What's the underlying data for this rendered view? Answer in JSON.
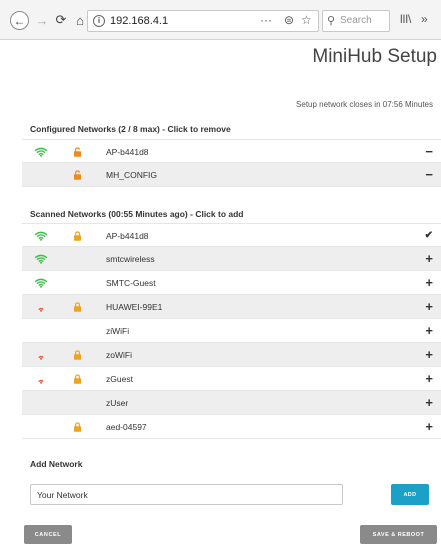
{
  "browser": {
    "url": "192.168.4.1",
    "search_placeholder": "Search",
    "back_glyph": "←",
    "forward_glyph": "→",
    "reload_glyph": "⟳",
    "home_glyph": "⌂",
    "more_glyph": "···",
    "pocket_glyph": "⊜",
    "star_glyph": "☆",
    "library_glyph": "lll\\",
    "overflow_glyph": "»"
  },
  "page": {
    "title": "MiniHub Setup",
    "setup_closes": "Setup network closes in 07:56 Minutes"
  },
  "configured": {
    "title": "Configured Networks (2 / 8 max) - Click to remove",
    "networks": [
      {
        "ssid": "AP-b441d8",
        "signal": "strong",
        "security": "config",
        "action": "−"
      },
      {
        "ssid": "MH_CONFIG",
        "signal": "none",
        "security": "config",
        "action": "−"
      }
    ]
  },
  "scanned": {
    "title": "Scanned Networks (00:55 Minutes ago) - Click to add",
    "networks": [
      {
        "ssid": "AP-b441d8",
        "signal": "strong",
        "locked": true,
        "action": "✔"
      },
      {
        "ssid": "smtcwireless",
        "signal": "strong",
        "locked": false,
        "action": "+"
      },
      {
        "ssid": "SMTC-Guest",
        "signal": "strong",
        "locked": false,
        "action": "+"
      },
      {
        "ssid": "HUAWEI-99E1",
        "signal": "weak",
        "locked": true,
        "action": "+"
      },
      {
        "ssid": "ziWiFi",
        "signal": "none",
        "locked": false,
        "action": "+"
      },
      {
        "ssid": "zoWiFi",
        "signal": "weak",
        "locked": true,
        "action": "+"
      },
      {
        "ssid": "zGuest",
        "signal": "weak",
        "locked": true,
        "action": "+"
      },
      {
        "ssid": "zUser",
        "signal": "none",
        "locked": false,
        "action": "+"
      },
      {
        "ssid": "aed-04597",
        "signal": "none",
        "locked": true,
        "action": "+"
      }
    ]
  },
  "add_network": {
    "title": "Add Network",
    "input_value": "Your Network",
    "add_label": "ADD"
  },
  "buttons": {
    "cancel_label": "CANCEL",
    "save_reboot_label": "SAVE & REBOOT"
  },
  "colors": {
    "wifi_strong": "#3dbf4a",
    "wifi_weak": "#e8593a",
    "wifi_none": "#d6d6d6",
    "lock": "#f0a320",
    "config_lock": "#f08a1e",
    "accent": "#1ba1c7",
    "button_gray": "#8a8a8a",
    "row_shade": "#eeeeee"
  }
}
